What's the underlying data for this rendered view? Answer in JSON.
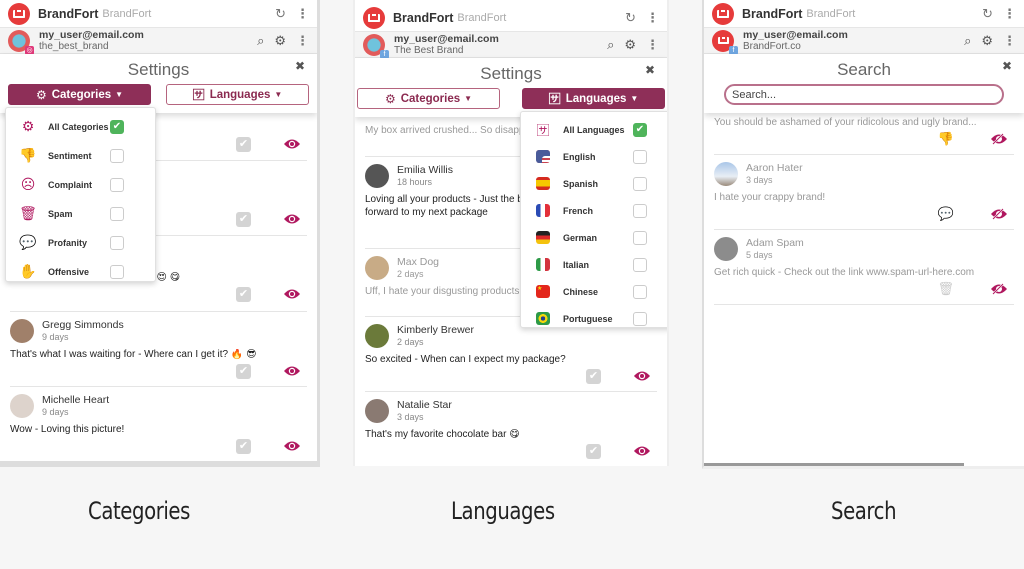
{
  "panels": [
    {
      "id": "categories",
      "caption": "Categories",
      "topbar": {
        "brand": "BrandFort",
        "brand_sub": "BrandFort"
      },
      "account": {
        "email": "my_user@email.com",
        "name": "the_best_brand",
        "social": "instagram"
      },
      "settings": {
        "title": "Settings",
        "buttons": [
          {
            "label": "Categories",
            "icon": "gear-icon",
            "active": true
          },
          {
            "label": "Languages",
            "icon": "translate-icon",
            "active": false
          }
        ]
      },
      "dropdown": {
        "items": [
          {
            "label": "All Categories",
            "icon": "gear-icon",
            "checked": true
          },
          {
            "label": "Sentiment",
            "icon": "thumbs-down-icon",
            "checked": false
          },
          {
            "label": "Complaint",
            "icon": "sad-face-icon",
            "checked": false
          },
          {
            "label": "Spam",
            "icon": "trash-icon",
            "checked": false
          },
          {
            "label": "Profanity",
            "icon": "profanity-bubble-icon",
            "checked": false
          },
          {
            "label": "Offensive",
            "icon": "hand-icon",
            "checked": false
          }
        ]
      },
      "posts": [
        {
          "name": "",
          "time": "",
          "text": ""
        },
        {
          "name": "",
          "time": "",
          "text": ""
        },
        {
          "name": "",
          "time": "",
          "text": "s! 😍 😋"
        },
        {
          "name": "Gregg Simmonds",
          "time": "9 days",
          "text": "That's what I was waiting for - Where can I get it? 🔥 😎"
        },
        {
          "name": "Michelle Heart",
          "time": "9 days",
          "text": "Wow - Loving this picture!"
        }
      ]
    },
    {
      "id": "languages",
      "caption": "Languages",
      "topbar": {
        "brand": "BrandFort",
        "brand_sub": "BrandFort"
      },
      "account": {
        "email": "my_user@email.com",
        "name": "The Best Brand",
        "social": "facebook"
      },
      "settings": {
        "title": "Settings",
        "buttons": [
          {
            "label": "Categories",
            "icon": "gear-icon",
            "active": false
          },
          {
            "label": "Languages",
            "icon": "translate-icon",
            "active": true
          }
        ]
      },
      "dropdown": {
        "items": [
          {
            "label": "All Languages",
            "icon": "translate-icon",
            "checked": true
          },
          {
            "label": "English",
            "icon": "flag-us-icon",
            "checked": false
          },
          {
            "label": "Spanish",
            "icon": "flag-es-icon",
            "checked": false
          },
          {
            "label": "French",
            "icon": "flag-fr-icon",
            "checked": false
          },
          {
            "label": "German",
            "icon": "flag-de-icon",
            "checked": false
          },
          {
            "label": "Italian",
            "icon": "flag-it-icon",
            "checked": false
          },
          {
            "label": "Chinese",
            "icon": "flag-cn-icon",
            "checked": false
          },
          {
            "label": "Portuguese",
            "icon": "flag-br-icon",
            "checked": false
          }
        ]
      },
      "posts": [
        {
          "name": "",
          "time": "",
          "text": "My box arrived crushed... So disapp",
          "faded": true
        },
        {
          "name": "Emilia Willis",
          "time": "18 hours",
          "text": "Loving all your products - Just the b",
          "text2": "forward to my next package"
        },
        {
          "name": "Max Dog",
          "time": "2 days",
          "text": "Uff, I hate your disgusting products",
          "faded": true
        },
        {
          "name": "Kimberly Brewer",
          "time": "2 days",
          "text": "So excited - When can I expect my package?"
        },
        {
          "name": "Natalie Star",
          "time": "3 days",
          "text": "That's my favorite chocolate bar 😋"
        }
      ]
    },
    {
      "id": "search",
      "caption": "Search",
      "topbar": {
        "brand": "BrandFort",
        "brand_sub": "BrandFort"
      },
      "account": {
        "email": "my_user@email.com",
        "name": "BrandFort.co",
        "social": "facebook"
      },
      "search": {
        "title": "Search",
        "placeholder": "Search...",
        "value": ""
      },
      "posts": [
        {
          "name": "",
          "time": "",
          "text": "You should be ashamed of your ridicolous and ugly brand...",
          "category_icon": "thumbs-down-icon"
        },
        {
          "name": "Aaron Hater",
          "time": "3 days",
          "text": "I hate your crappy brand!",
          "category_icon": "profanity-bubble-icon"
        },
        {
          "name": "Adam Spam",
          "time": "5 days",
          "text": "Get rich quick - Check out the link www.spam-url-here.com",
          "category_icon": "trash-icon"
        }
      ]
    }
  ],
  "colors": {
    "accent": "#8e2f58",
    "eye": "#b0185f",
    "check_on": "#4fb45b",
    "logo": "#e63b3b"
  }
}
